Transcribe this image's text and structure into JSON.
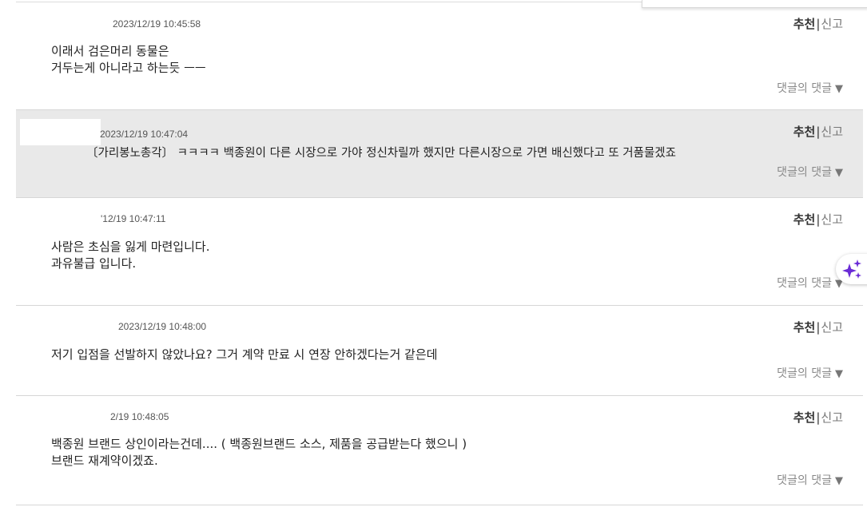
{
  "actions": {
    "recommend": "추천",
    "separator": "|",
    "report": "신고"
  },
  "reply_toggle": {
    "label": "댓글의 댓글",
    "arrow": "▼"
  },
  "comments": [
    {
      "date": "2023/12/19 10:45:58",
      "lines": [
        "이래서 검은머리 동물은",
        "거두는게 아니라고 하는듯 ㅡㅡ"
      ]
    },
    {
      "date": "2023/12/19 10:47:04",
      "lines": [
        "〔가리봉노총각〕 ㅋㅋㅋㅋ 백종원이 다른 시장으로 가야 정신차릴까 했지만 다른시장으로 가면 배신했다고 또 거품물겠죠"
      ]
    },
    {
      "date": "'12/19 10:47:11",
      "lines": [
        "사람은 초심을 잃게 마련입니다.",
        "과유불급 입니다."
      ]
    },
    {
      "date": "2023/12/19 10:48:00",
      "lines": [
        "저기 입점을 선발하지 않았나요? 그거 계약 만료 시 연장 안하겠다는거 같은데"
      ]
    },
    {
      "date": "2/19 10:48:05",
      "lines": [
        "백종원 브랜드 상인이라는건데.... ( 백종원브랜드 소스, 제품을 공급받는다 했으니 )",
        "브랜드 재계약이겠죠."
      ]
    }
  ],
  "icons": {
    "ai_sparkle": "sparkle-icon",
    "accent": "#6a2bd6"
  }
}
